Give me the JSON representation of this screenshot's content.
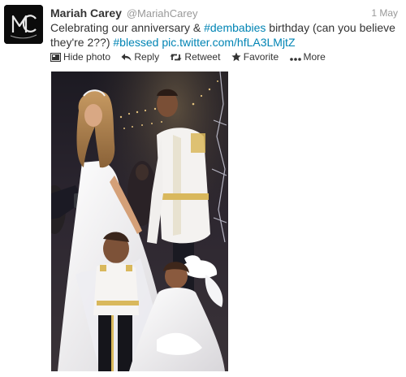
{
  "tweet": {
    "author": {
      "name": "Mariah Carey",
      "handle": "@MariahCarey",
      "avatar_monogram": "MC"
    },
    "timestamp": "1 May",
    "text": {
      "part1": "Celebrating our anniversary & ",
      "hashtag1": "#dembabies",
      "part2": " birthday (can you believe they're 2??) ",
      "hashtag2": "#blessed",
      "part3": " ",
      "link": "pic.twitter.com/hfLA3LMjtZ"
    },
    "actions": {
      "hide_photo": "Hide photo",
      "reply": "Reply",
      "retweet": "Retweet",
      "favorite": "Favorite",
      "more": "More"
    },
    "colors": {
      "link": "#0084b4",
      "meta": "#999999",
      "text": "#333333"
    },
    "icons": [
      "photo-icon",
      "reply-arrow-icon",
      "retweet-icon",
      "star-icon",
      "more-dots-icon"
    ]
  }
}
